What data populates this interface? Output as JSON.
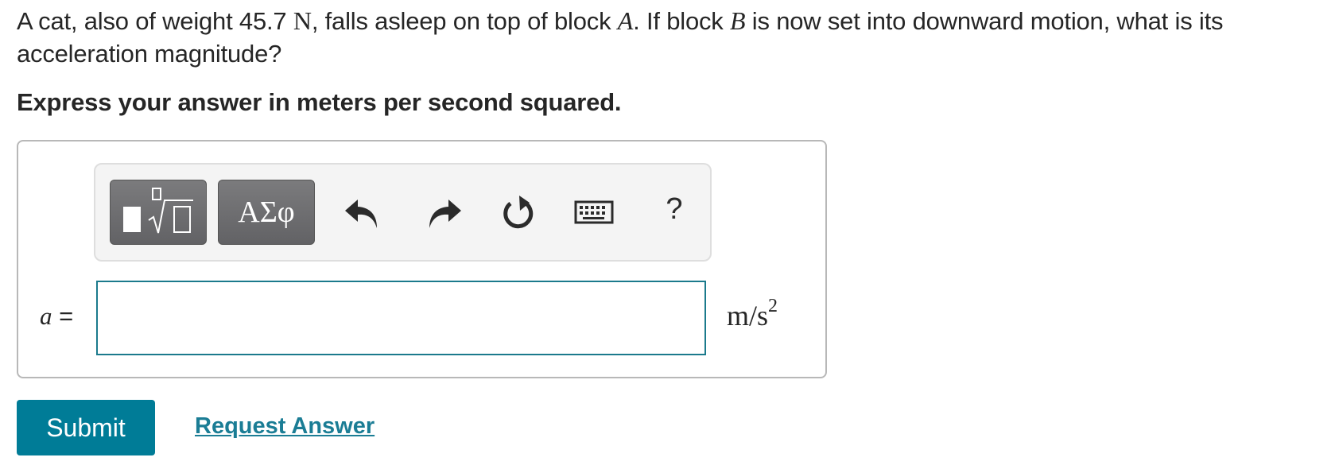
{
  "question": {
    "part1": "A cat, also of weight 45.7 ",
    "unit_newton": "N",
    "part2": ", falls asleep on top of block ",
    "block_a": "A",
    "part3": ". If block ",
    "block_b": "B",
    "part4": " is now set into downward motion, what is its acceleration magnitude?"
  },
  "instruction": "Express your answer in meters per second squared.",
  "toolbar": {
    "templates_icon": "templates-icon",
    "symbols_label": "ΑΣφ",
    "undo_icon": "undo-icon",
    "redo_icon": "redo-icon",
    "reset_icon": "reset-icon",
    "keyboard_icon": "keyboard-icon",
    "help_label": "?"
  },
  "answer": {
    "variable": "a",
    "equals": " =",
    "value": "",
    "unit_base": "m/s",
    "unit_exp": "2"
  },
  "actions": {
    "submit_label": "Submit",
    "request_label": "Request Answer"
  },
  "colors": {
    "accent": "#007c97",
    "input_border": "#1b7a8c",
    "toolbar_button": "#6e6e70"
  }
}
